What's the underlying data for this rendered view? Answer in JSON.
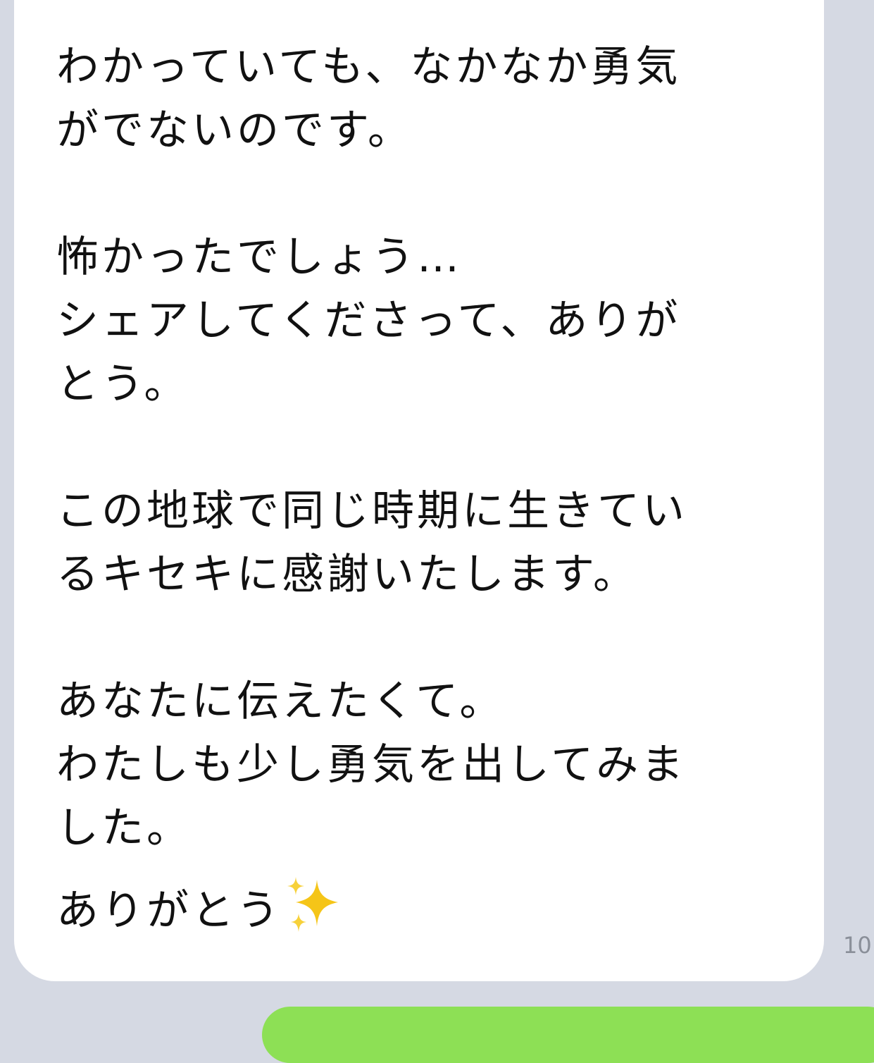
{
  "message": {
    "paragraph1": [
      "わかっていても、なかなか勇気",
      "がでないのです。"
    ],
    "paragraph2": [
      "怖かったでしょう…",
      "シェアしてくださって、ありが",
      "とう。"
    ],
    "paragraph3": [
      "この地球で同じ時期に生きてい",
      "るキセキに感謝いたします。"
    ],
    "paragraph4": [
      "あなたに伝えたくて。",
      "わたしも少し勇気を出してみま",
      "した。"
    ],
    "closing": "ありがとう",
    "closing_emoji_icon": "sparkles-icon"
  },
  "timestamp": "10",
  "colors": {
    "background": "#d5d9e3",
    "bubble": "#ffffff",
    "outgoing_bubble": "#8de055",
    "sparkle": "#f5c518",
    "timestamp": "#8a8f99"
  }
}
